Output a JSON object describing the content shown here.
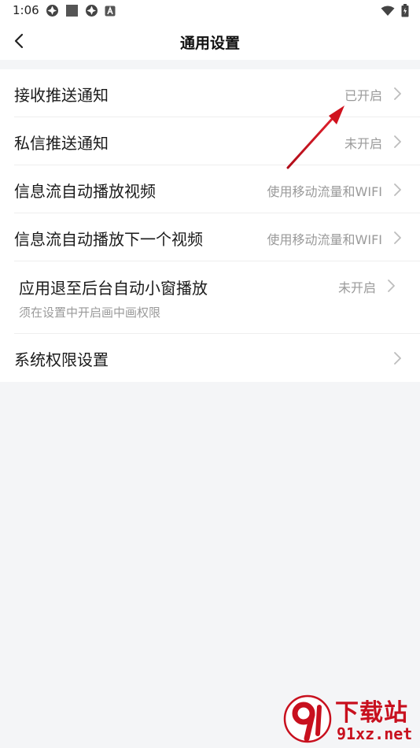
{
  "status_bar": {
    "time": "1:06"
  },
  "header": {
    "title": "通用设置"
  },
  "settings": [
    {
      "label": "接收推送通知",
      "value": "已开启"
    },
    {
      "label": "私信推送通知",
      "value": "未开启"
    },
    {
      "label": "信息流自动播放视频",
      "value": "使用移动流量和WIFI"
    },
    {
      "label": "信息流自动播放下一个视频",
      "value": "使用移动流量和WIFI"
    },
    {
      "label": "应用退至后台自动小窗播放",
      "value": "未开启",
      "sublabel": "须在设置中开启画中画权限"
    },
    {
      "label": "系统权限设置",
      "value": ""
    }
  ],
  "watermark": {
    "brand": "下载站",
    "domain": "91xz.net"
  },
  "colors": {
    "page_background": "#f4f5f7",
    "row_background": "#ffffff",
    "label_text": "#1a1a1a",
    "value_text": "#9a9a9a",
    "annotation_arrow": "#d0121e",
    "watermark": "#c8101e"
  },
  "icons": {
    "back": "chevron-left-icon",
    "row_arrow": "chevron-right-icon",
    "wifi": "wifi-icon",
    "battery": "battery-icon"
  }
}
